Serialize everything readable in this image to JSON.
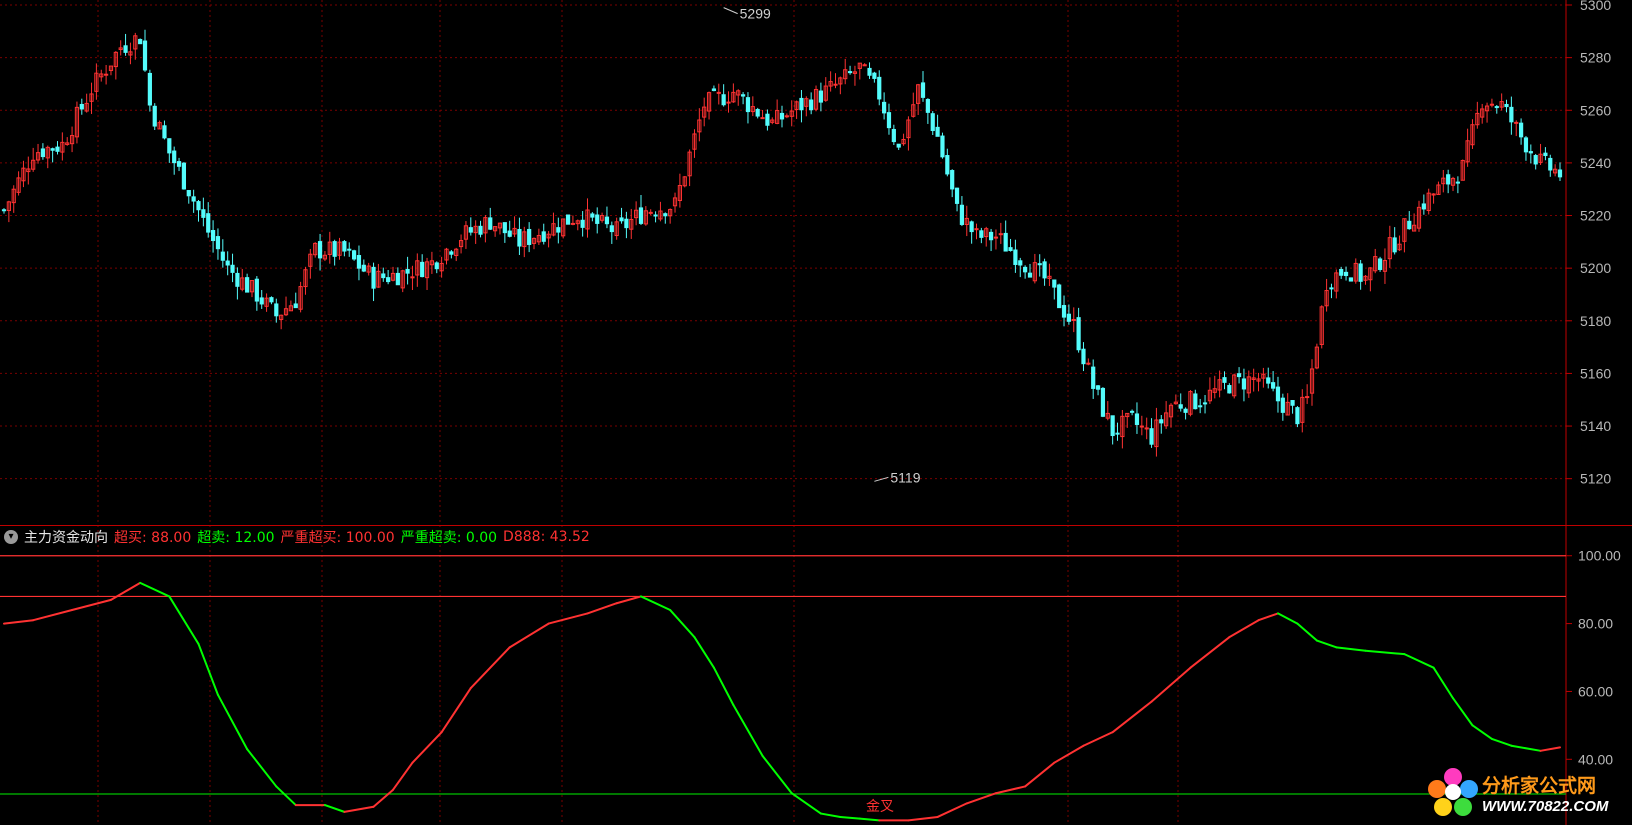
{
  "chart_data": [
    {
      "type": "candlestick",
      "ylim": [
        5110,
        5300
      ],
      "y_ticks": [
        "5120",
        "5140",
        "5160",
        "5180",
        "5200",
        "5220",
        "5240",
        "5260",
        "5280",
        "5300"
      ],
      "annotations": [
        {
          "text": "5299",
          "value": 5299,
          "bar": 148
        },
        {
          "text": "5119",
          "value": 5119,
          "bar": 179
        }
      ],
      "colors": {
        "up": "#ff3232",
        "down": "#54fcfc"
      },
      "candles": []
    },
    {
      "type": "line",
      "title": "主力资金动向",
      "ylim": [
        28,
        107
      ],
      "y_ticks": [
        "100.00",
        "80.00",
        "60.00",
        "40.00"
      ],
      "legend": [
        {
          "label": "超买",
          "value": "88.00",
          "color": "#ff3232"
        },
        {
          "label": "超卖",
          "value": "12.00",
          "color": "#00ff00"
        },
        {
          "label": "严重超买",
          "value": "100.00",
          "color": "#ff3232"
        },
        {
          "label": "严重超卖",
          "value": "0.00",
          "color": "#00ff00"
        },
        {
          "label": "D888",
          "value": "43.52",
          "color": "#ff3232"
        }
      ],
      "reference_lines": [
        {
          "value": 100,
          "color": "#ff3232"
        },
        {
          "value": 88,
          "color": "#ff3232"
        }
      ],
      "curve_colors": {
        "rising": "#ff3232",
        "falling": "#00ff00"
      },
      "series": [
        {
          "name": "D888",
          "points": [
            [
              0,
              80
            ],
            [
              6,
              81
            ],
            [
              14,
              84
            ],
            [
              22,
              87
            ],
            [
              28,
              92
            ],
            [
              34,
              88
            ],
            [
              40,
              74
            ],
            [
              44,
              59
            ],
            [
              50,
              43
            ],
            [
              56,
              32
            ],
            [
              60,
              26.5
            ],
            [
              66,
              26.5
            ],
            [
              70,
              24.5
            ],
            [
              76,
              26
            ],
            [
              80,
              31
            ],
            [
              84,
              39
            ],
            [
              90,
              48
            ],
            [
              96,
              61
            ],
            [
              104,
              73
            ],
            [
              112,
              80
            ],
            [
              120,
              83
            ],
            [
              126,
              86
            ],
            [
              131,
              88
            ],
            [
              137,
              84
            ],
            [
              142,
              76
            ],
            [
              146,
              67
            ],
            [
              150,
              56
            ],
            [
              156,
              41
            ],
            [
              162,
              30
            ],
            [
              168,
              24
            ],
            [
              172,
              23
            ],
            [
              176,
              22.5
            ],
            [
              180,
              22
            ],
            [
              186,
              22
            ],
            [
              192,
              23
            ],
            [
              198,
              27
            ],
            [
              204,
              30
            ],
            [
              210,
              32
            ],
            [
              216,
              39
            ],
            [
              222,
              44
            ],
            [
              228,
              48
            ],
            [
              236,
              57
            ],
            [
              244,
              67
            ],
            [
              252,
              76
            ],
            [
              258,
              81
            ],
            [
              262,
              83
            ],
            [
              266,
              80
            ],
            [
              270,
              75
            ],
            [
              274,
              73
            ],
            [
              280,
              72
            ],
            [
              288,
              71
            ],
            [
              294,
              67
            ],
            [
              298,
              58
            ],
            [
              302,
              50
            ],
            [
              306,
              46
            ],
            [
              310,
              44
            ],
            [
              316,
              42.5
            ],
            [
              320,
              43.5
            ]
          ]
        }
      ]
    }
  ],
  "signal_label": "金叉",
  "watermark": {
    "title": "分析家公式网",
    "url": "WWW.70822.COM"
  }
}
